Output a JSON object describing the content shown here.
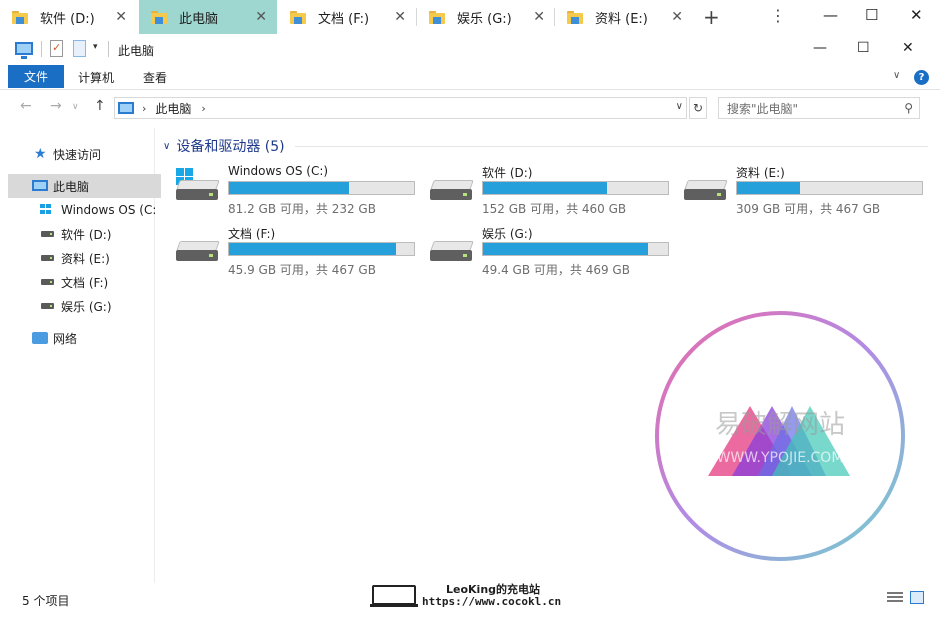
{
  "tabs": [
    {
      "label": "软件 (D:)",
      "active": false
    },
    {
      "label": "此电脑",
      "active": true
    },
    {
      "label": "文档 (F:)",
      "active": false
    },
    {
      "label": "娱乐 (G:)",
      "active": false
    },
    {
      "label": "资料 (E:)",
      "active": false
    }
  ],
  "tab_close": "✕",
  "tab_add": "+",
  "tab_more": "⋮",
  "window_controls": {
    "minimize": "—",
    "maximize": "☐",
    "close": "✕"
  },
  "quick_toolbar": {
    "title": "此电脑",
    "dropdown": "▾"
  },
  "ribbon": {
    "file": "文件",
    "tabs": [
      "计算机",
      "查看"
    ],
    "collapse": "∨",
    "help": "?"
  },
  "address": {
    "back": "←",
    "forward": "→",
    "up": "↑",
    "sep": "›",
    "crumb": "此电脑",
    "dropdown": "∨",
    "refresh": "↻"
  },
  "search": {
    "placeholder": "搜索\"此电脑\"",
    "icon": "⚲"
  },
  "nav_pane": {
    "quick_access": "快速访问",
    "this_pc": "此电脑",
    "drives": [
      "Windows OS (C:)",
      "软件 (D:)",
      "资料 (E:)",
      "文档 (F:)",
      "娱乐 (G:)"
    ],
    "network": "网络"
  },
  "section": {
    "chevron": "∨",
    "title": "设备和驱动器 (5)"
  },
  "drives": [
    {
      "name": "Windows OS (C:)",
      "free": "81.2 GB 可用，共 232 GB",
      "used_fraction": 0.65,
      "system": true
    },
    {
      "name": "软件 (D:)",
      "free": "152 GB 可用，共 460 GB",
      "used_fraction": 0.67,
      "system": false
    },
    {
      "name": "资料 (E:)",
      "free": "309 GB 可用，共 467 GB",
      "used_fraction": 0.34,
      "system": false
    },
    {
      "name": "文档 (F:)",
      "free": "45.9 GB 可用，共 467 GB",
      "used_fraction": 0.9,
      "system": false
    },
    {
      "name": "娱乐 (G:)",
      "free": "49.4 GB 可用，共 469 GB",
      "used_fraction": 0.89,
      "system": false
    }
  ],
  "bar_color": "#26a0da",
  "watermark": {
    "text": "易破解网站",
    "url": "WWW.YPOJIE.COM"
  },
  "status": {
    "items": "5 个项目"
  },
  "brand": {
    "line1": "LeoKing的充电站",
    "line2": "https://www.cocokl.cn"
  }
}
